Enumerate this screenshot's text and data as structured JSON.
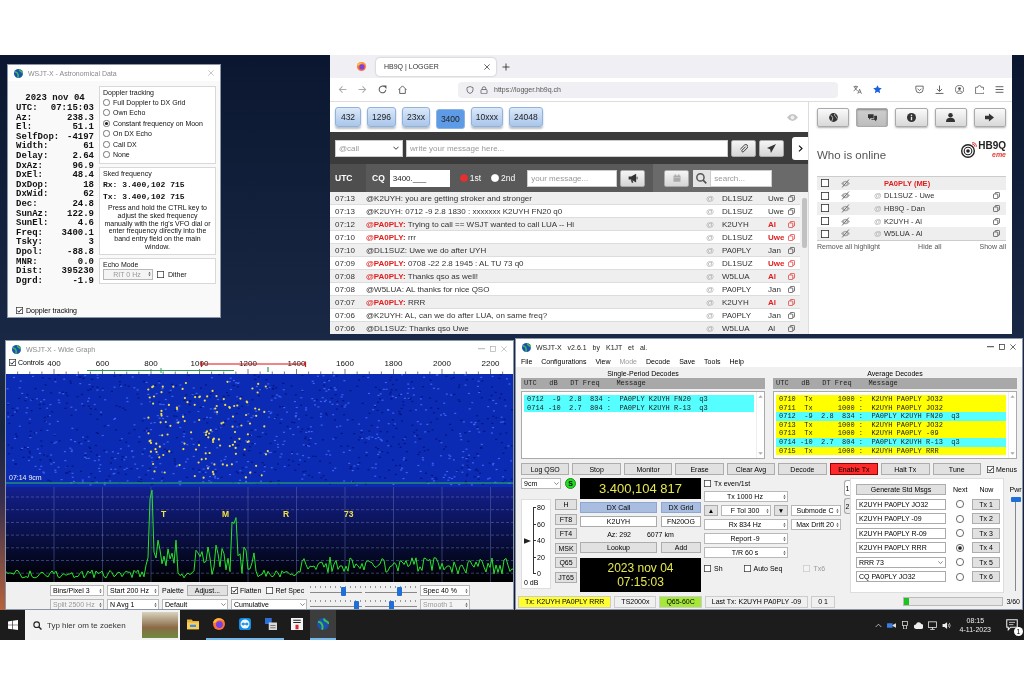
{
  "astro": {
    "title": "WSJT-X - Astronomical Data",
    "date": "2023 nov 04",
    "readings": [
      {
        "label": "UTC:",
        "value": "07:15:03"
      },
      {
        "label": "Az:",
        "value": "238.3"
      },
      {
        "label": "El:",
        "value": "51.1"
      },
      {
        "label": "SelfDop:",
        "value": "-4197"
      },
      {
        "label": "Width:",
        "value": "61"
      },
      {
        "label": "Delay:",
        "value": "2.64"
      },
      {
        "label": "DxAz:",
        "value": "96.9"
      },
      {
        "label": "DxEl:",
        "value": "48.4"
      },
      {
        "label": "DxDop:",
        "value": "18"
      },
      {
        "label": "DxWid:",
        "value": "62"
      },
      {
        "label": "Dec:",
        "value": "24.8"
      },
      {
        "label": "SunAz:",
        "value": "122.9"
      },
      {
        "label": "SunEl:",
        "value": "4.6"
      },
      {
        "label": "Freq:",
        "value": "3400.1"
      },
      {
        "label": "Tsky:",
        "value": "3"
      },
      {
        "label": "Dpol:",
        "value": "-88.8"
      },
      {
        "label": "MNR:",
        "value": "0.0"
      },
      {
        "label": "Dist:",
        "value": "395230"
      },
      {
        "label": "Dgrd:",
        "value": "-1.9"
      }
    ],
    "doppler": {
      "title": "Doppler tracking",
      "options": [
        {
          "label": "Full Doppler to DX Grid",
          "selected": false
        },
        {
          "label": "Own Echo",
          "selected": false
        },
        {
          "label": "Constant frequency on Moon",
          "selected": true
        },
        {
          "label": "On DX Echo",
          "selected": false
        },
        {
          "label": "Call DX",
          "selected": false
        },
        {
          "label": "None",
          "selected": false
        }
      ]
    },
    "sked": {
      "title": "Sked frequency",
      "rx": "Rx: 3.400,102 715",
      "tx": "Tx: 3.400,102 715",
      "note": "Press and hold the CTRL key to adjust the sked frequency manually with the rig's VFO dial or enter frequency directly into the band entry field on the main window."
    },
    "echo": {
      "title": "Echo Mode",
      "rit": {
        "value": "RIT 0 Hz",
        "disabled": true
      },
      "dither": {
        "label": "Dither",
        "checked": false
      }
    },
    "tracking": {
      "label": "Doppler tracking",
      "checked": true
    }
  },
  "browser": {
    "tab": "HB9Q | LOGGER",
    "url": "https://logger.hb9q.ch",
    "bands": [
      {
        "label": "432",
        "selected": false
      },
      {
        "label": "1296",
        "selected": false
      },
      {
        "label": "23xx",
        "selected": false
      },
      {
        "label": "3400",
        "selected": true
      },
      {
        "label": "10xxx",
        "selected": false
      },
      {
        "label": "24048",
        "selected": false
      }
    ],
    "compose": {
      "recipient": "@call",
      "placeholder": "write your message here..."
    },
    "cq": {
      "utc": "UTC",
      "label": "CQ",
      "frequency": "3400.___",
      "periods": [
        {
          "label": "1st",
          "selected": true
        },
        {
          "label": "2nd",
          "selected": false
        }
      ],
      "placeholder": "your message...",
      "search_placeholder": "search..."
    },
    "chat": [
      {
        "time": "07:13",
        "message": "@K2UYH: you are getting stroker and stronger",
        "highlight": false,
        "at": "@",
        "call": "DL1SUZ",
        "name": "Uwe"
      },
      {
        "time": "07:13",
        "message": "@K2UYH: 0712 -9 2.8 1830 : xxxxxxx K2UYH FN20 q0",
        "highlight": false,
        "at": "@",
        "call": "DL1SUZ",
        "name": "Uwe"
      },
      {
        "time": "07:12",
        "message": "**@PA0PLY:** Trying to call == WSJT wanted to call LUA -- Hi",
        "highlight": true,
        "at": "@",
        "call": "K2UYH",
        "name": "Al"
      },
      {
        "time": "07:10",
        "message": "**@PA0PLY:** rrr",
        "highlight": true,
        "at": "@",
        "call": "DL1SUZ",
        "name": "Uwe"
      },
      {
        "time": "07:10",
        "message": "@DL1SUZ: Uwe we do after UYH",
        "highlight": false,
        "at": "@",
        "call": "PA0PLY",
        "name": "Jan"
      },
      {
        "time": "07:09",
        "message": "**@PA0PLY:** 0708 -22 2.8 1945 : AL TU 73 q0",
        "highlight": true,
        "at": "@",
        "call": "DL1SUZ",
        "name": "Uwe"
      },
      {
        "time": "07:08",
        "message": "**@PA0PLY:** Thanks qso as well!",
        "highlight": true,
        "at": "@",
        "call": "W5LUA",
        "name": "Al"
      },
      {
        "time": "07:08",
        "message": "@W5LUA: AL thanks for nice QSO",
        "highlight": false,
        "at": "@",
        "call": "PA0PLY",
        "name": "Jan"
      },
      {
        "time": "07:07",
        "message": "**@PA0PLY:** RRR",
        "highlight": true,
        "at": "@",
        "call": "K2UYH",
        "name": "Al"
      },
      {
        "time": "07:06",
        "message": "@K2UYH: AL, can we do after LUA, on same freq?",
        "highlight": false,
        "at": "@",
        "call": "PA0PLY",
        "name": "Jan"
      },
      {
        "time": "07:06",
        "message": "@DL1SUZ: Thanks qso Uwe",
        "highlight": false,
        "at": "@",
        "call": "W5LUA",
        "name": "Al"
      }
    ],
    "panel": {
      "nav": [
        {
          "kind": "globe",
          "selected": false
        },
        {
          "kind": "chat",
          "selected": true
        },
        {
          "kind": "info",
          "selected": false
        },
        {
          "kind": "user",
          "selected": false
        },
        {
          "kind": "logout",
          "selected": false
        }
      ],
      "heading": "Who is online",
      "logo": {
        "name": "HB9Q",
        "tagline": "eme"
      },
      "users": [
        {
          "name": "PA0PLY (ME)",
          "me": true,
          "checked": false
        },
        {
          "at": "@",
          "name": "DL1SUZ - Uwe",
          "me": false,
          "checked": false
        },
        {
          "at": "@",
          "name": "HB9Q - Dan",
          "me": false,
          "checked": false
        },
        {
          "at": "@",
          "name": "K2UYH - Al",
          "me": false,
          "checked": false
        },
        {
          "at": "@",
          "name": "W5LUA - Al",
          "me": false,
          "checked": false
        }
      ],
      "links": [
        "Remove all highlight",
        "Hide all",
        "Show all"
      ]
    }
  },
  "wide_graph": {
    "title": "WSJT-X - Wide Graph",
    "controls": {
      "label": "Controls",
      "checked": true
    },
    "scale": [
      "400",
      "600",
      "800",
      "1000",
      "1200",
      "1400",
      "1600",
      "1800",
      "2000",
      "2200"
    ],
    "timestamp": "07:14 9cm",
    "markers": [
      "T",
      "M",
      "R",
      "73"
    ],
    "settings": {
      "bins": {
        "value": "Bins/Pixel 3",
        "disabled": false
      },
      "start": {
        "value": "Start 200 Hz",
        "disabled": false
      },
      "palette_label": "Palette",
      "adjust": "Adjust...",
      "flatten": {
        "label": "Flatten",
        "checked": true
      },
      "ref_spec": {
        "label": "Ref Spec",
        "checked": false
      },
      "spec": {
        "value": "Spec 40 %",
        "disabled": false
      },
      "split": {
        "value": "Split 2500 Hz",
        "disabled": true
      },
      "navg": {
        "value": "N Avg 1",
        "disabled": false
      },
      "palette": "Default",
      "mode": "Cumulative",
      "smooth": {
        "value": "Smooth 1",
        "disabled": true
      },
      "sliders": [
        {
          "level": 0.66
        },
        {
          "level": 0.69
        },
        {
          "level": 0.94
        },
        {
          "level": 0.5
        }
      ]
    }
  },
  "main": {
    "title": "WSJT-X v2.6.1 by K1JT et al.",
    "menu": [
      {
        "label": "File",
        "disabled": false
      },
      {
        "label": "Configurations",
        "disabled": false
      },
      {
        "label": "View",
        "disabled": false
      },
      {
        "label": "Mode",
        "disabled": true
      },
      {
        "label": "Decode",
        "disabled": false
      },
      {
        "label": "Save",
        "disabled": false
      },
      {
        "label": "Tools",
        "disabled": false
      },
      {
        "label": "Help",
        "disabled": false
      }
    ],
    "single": {
      "title": "Single-Period Decodes",
      "header": "UTC   dB   DT Freq    Message",
      "rows": [
        {
          "text": "0712  -9  2.8  834 :  PA0PLY K2UYH FN20  q3",
          "color": "#55ffff"
        },
        {
          "text": "0714 -10  2.7  804 :  PA0PLY K2UYH R-13  q3",
          "color": "#55ffff"
        }
      ]
    },
    "average": {
      "title": "Average Decodes",
      "header": "UTC   dB   DT Freq    Message",
      "rows": [
        {
          "text": "0710  Tx      1000 :  K2UYH PA0PLY JO32",
          "color": "#ffff00"
        },
        {
          "text": "0711  Tx      1000 :  K2UYH PA0PLY JO32",
          "color": "#ffff00"
        },
        {
          "text": "0712  -9  2.8  834 :  PA0PLY K2UYH FN20  q3",
          "color": "#55ffff"
        },
        {
          "text": "0713  Tx      1000 :  K2UYH PA0PLY JO32",
          "color": "#ffff00"
        },
        {
          "text": "0713  Tx      1000 :  K2UYH PA0PLY -09",
          "color": "#ffff00"
        },
        {
          "text": "0714 -10  2.7  804 :  PA0PLY K2UYH R-13  q3",
          "color": "#55ffff"
        },
        {
          "text": "0715  Tx      1000 :  K2UYH PA0PLY RRR",
          "color": "#ffff00"
        }
      ]
    },
    "buttons": [
      {
        "label": "Log QSO",
        "on": false
      },
      {
        "label": "Stop",
        "on": false
      },
      {
        "label": "Monitor",
        "on": false
      },
      {
        "label": "Erase",
        "on": false
      },
      {
        "label": "Clear Avg",
        "on": false
      },
      {
        "label": "Decode",
        "on": false
      },
      {
        "label": "Enable Tx",
        "on": true
      },
      {
        "label": "Halt Tx",
        "on": false
      },
      {
        "label": "Tune",
        "on": false
      }
    ],
    "menus": {
      "label": "Menus",
      "checked": true
    },
    "band": "9cm",
    "indicator": "S",
    "frequency": "3.400,104 817",
    "meter": {
      "ticks": [
        "80",
        "60",
        "40",
        "20",
        "0"
      ],
      "level": 0.5,
      "unit": "0 dB"
    },
    "modes": [
      "H",
      "FT8",
      "FT4",
      "MSK",
      "Q65",
      "JT65"
    ],
    "dx_call_label": "DX Call",
    "dx_grid_label": "DX Grid",
    "dx_call": "K2UYH",
    "dx_grid": "FN20OG",
    "azimuth": "Az: 292",
    "distance": "6077 km",
    "lookup": "Lookup",
    "add": "Add",
    "date": "2023 nov 04",
    "time": "07:15:03",
    "tx_even": {
      "label": "Tx even/1st",
      "checked": false
    },
    "tx_freq": "Tx 1000 Hz",
    "up": "▲",
    "ftol": "F Tol 300",
    "down": "▼",
    "submode": "Submode C",
    "rx_freq": "Rx 834 Hz",
    "max_drift": "Max Drift 20",
    "report": "Report -9",
    "tr": "T/R 60 s",
    "checks": [
      {
        "label": "Sh",
        "checked": false,
        "disabled": false
      },
      {
        "label": "Auto Seq",
        "checked": false,
        "disabled": false
      },
      {
        "label": "Tx6",
        "checked": false,
        "disabled": true
      }
    ],
    "msg_tabs": [
      {
        "label": "1",
        "selected": true
      },
      {
        "label": "2",
        "selected": false
      }
    ],
    "generate": "Generate Std Msgs",
    "next": "Next",
    "now": "Now",
    "messages": [
      {
        "kind": "field",
        "text": "K2UYH PA0PLY JO32",
        "selected": false,
        "button": "Tx 1"
      },
      {
        "kind": "field",
        "text": "K2UYH PA0PLY -09",
        "selected": false,
        "button": "Tx 2"
      },
      {
        "kind": "field",
        "text": "K2UYH PA0PLY R-09",
        "selected": false,
        "button": "Tx 3"
      },
      {
        "kind": "field",
        "text": "K2UYH PA0PLY RRR",
        "selected": true,
        "button": "Tx 4"
      },
      {
        "kind": "combo",
        "text": "RRR 73",
        "selected": false,
        "button": "Tx 5"
      },
      {
        "kind": "field",
        "text": "CQ PA0PLY JO32",
        "selected": false,
        "button": "Tx 6"
      }
    ],
    "power": {
      "label": "Pwr",
      "level": 1
    },
    "status": {
      "tx": "Tx: K2UYH PA0PLY RRR",
      "rig": "TS2000x",
      "mode": "Q65-60C",
      "last_tx": "Last Tx: K2UYH PA0PLY -09",
      "counter": "0 1",
      "level": 0.05,
      "progress": "3/60"
    }
  },
  "taskbar": {
    "search_placeholder": "Typ hier om te zoeken",
    "apps": [
      {
        "kind": "folder",
        "running": false,
        "active": false
      },
      {
        "kind": "browser",
        "running": true,
        "active": false
      },
      {
        "kind": "remote",
        "running": true,
        "active": false
      },
      {
        "kind": "network",
        "running": true,
        "active": false
      },
      {
        "kind": "calendar",
        "running": false,
        "active": false
      },
      {
        "kind": "globe",
        "running": true,
        "active": true
      }
    ],
    "time": "08:15",
    "date": "4-11-2023",
    "notifications": "1"
  }
}
